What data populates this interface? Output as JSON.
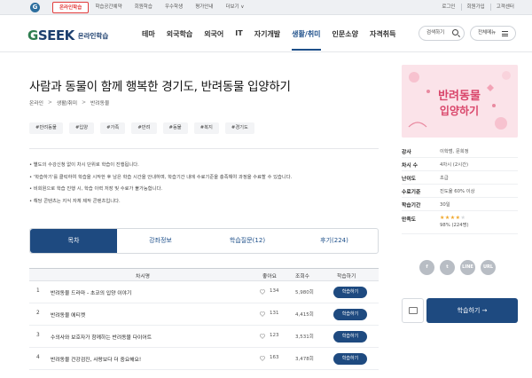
{
  "topbar": {
    "logo_letter": "G",
    "tabs": [
      "온라인학습",
      "학습공간예약",
      "회원학습",
      "우수학생",
      "평가안내",
      "더보기 ∨"
    ],
    "util": [
      "로그인",
      "회원가입",
      "고객센터"
    ]
  },
  "nav": {
    "brand_g": "G",
    "brand_seek": "SEEK",
    "brand_sub": "온라인학습",
    "menu": [
      "테마",
      "외국학습",
      "외국어",
      "IT",
      "자기개발",
      "생활/취미",
      "인문소양",
      "자격취득"
    ],
    "search_label": "검색하기",
    "allmenu_label": "전체메뉴"
  },
  "course": {
    "title": "사람과 동물이 함께 행복한 경기도, 반려동물 입양하기",
    "breadcrumb": [
      "온라인",
      "생활/취미",
      "반려동물"
    ],
    "tags": [
      "#반려동물",
      "#입양",
      "#가족",
      "#반려",
      "#동물",
      "#복지",
      "#경기도"
    ],
    "notes": [
      "• 별도의 수강신청 없이 차시 단위로 학습이 진행됩니다.",
      "• '학습하기'를 클릭하여 학습을 시작한 후 남은 학습 시간을 안내하며, 학습기간 내에 수료기준을 충족해야 과정을 수료할 수 있습니다.",
      "• 비회원으로 학습 진행 시, 학습 이력 저장 및 수료가 불가능합니다.",
      "• 해당 콘텐츠는 지식 자체 제작 콘텐츠입니다."
    ]
  },
  "tabs": [
    "목차",
    "강좌정보",
    "학습질문(12)",
    "후기(224)"
  ],
  "table": {
    "headers": [
      "차시명",
      "좋아요",
      "조회수",
      "학습하기"
    ],
    "rows": [
      {
        "no": "1",
        "name": "반려동물 드라마 - 초코의 입양 이야기",
        "likes": "134",
        "views": "5,980회",
        "btn": "학습하기"
      },
      {
        "no": "2",
        "name": "반려동물 에티켓",
        "likes": "131",
        "views": "4,415회",
        "btn": "학습하기"
      },
      {
        "no": "3",
        "name": "수의사와 보호자가 함께하는 반려동물 다이어트",
        "likes": "123",
        "views": "3,531회",
        "btn": "학습하기"
      },
      {
        "no": "4",
        "name": "반려동물 건강검진, 사랑보다 더 중요해요!",
        "likes": "163",
        "views": "3,478회",
        "btn": "학습하기"
      }
    ]
  },
  "thumb": {
    "line1": "반려동물",
    "line2": "입양하기"
  },
  "info": {
    "rows": [
      {
        "k": "강사",
        "v": "이학범, 문희정"
      },
      {
        "k": "차시 수",
        "v": "4차시 (2시간)"
      },
      {
        "k": "난이도",
        "v": "초급"
      },
      {
        "k": "수료기준",
        "v": "진도율 60% 이상"
      },
      {
        "k": "학습기간",
        "v": "30일"
      }
    ],
    "rating_label": "만족도",
    "rating_stars": 4,
    "rating_text": "98% (224명)"
  },
  "share": [
    "f",
    "t",
    "LINE",
    "URL"
  ],
  "cta": {
    "label": "학습하기 →"
  },
  "colors": {
    "primary": "#1e4a80",
    "accent_red": "#e23b3b",
    "brand_green": "#2e7d4f",
    "star": "#f0a72c"
  }
}
